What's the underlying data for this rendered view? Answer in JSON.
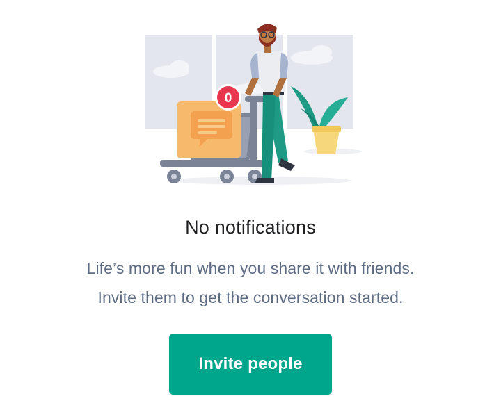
{
  "empty_state": {
    "badge_count": "0",
    "title": "No notifications",
    "description_line1": "Life’s more fun when you share it with friends.",
    "description_line2": "Invite them to get the conversation started.",
    "cta_label": "Invite people"
  },
  "colors": {
    "accent": "#00a68b",
    "title": "#1e1f21",
    "body_text": "#5e6c84",
    "badge": "#e8384f"
  },
  "icons": [
    "notification-badge-icon",
    "chat-bubble-icon",
    "plant-icon",
    "shopping-cart-icon"
  ]
}
